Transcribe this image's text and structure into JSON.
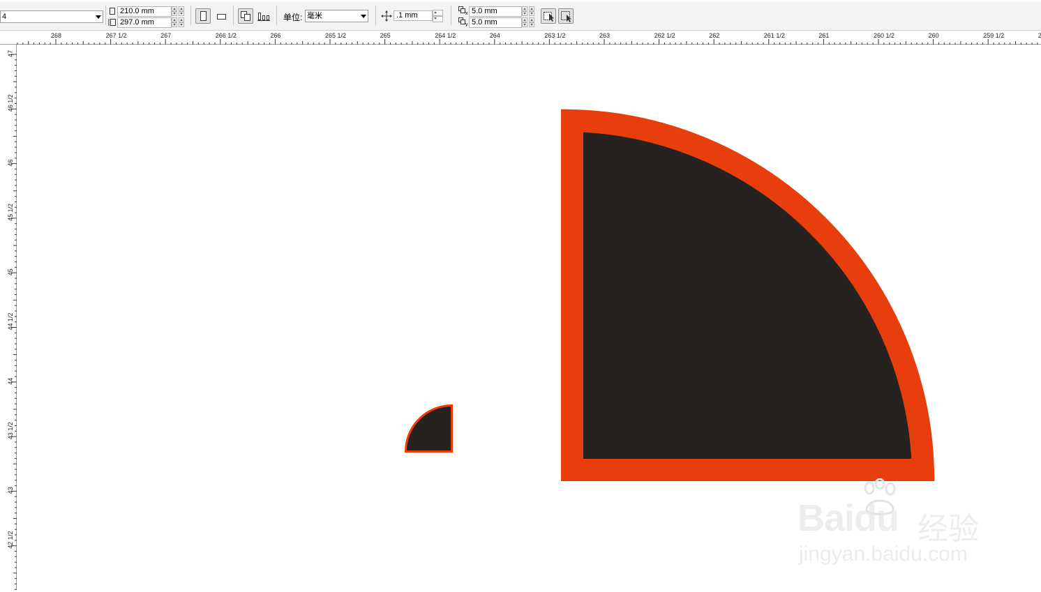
{
  "toolbar": {
    "paper_preset": "4",
    "page_width": "210.0 mm",
    "page_height": "297.0 mm",
    "units_label": "单位:",
    "units_value": "毫米",
    "nudge_value": ".1 mm",
    "dup_x": "5.0 mm",
    "dup_y": "5.0 mm"
  },
  "ruler_h": {
    "labels": [
      "268",
      "267 1/2",
      "267",
      "266 1/2",
      "266",
      "265 1/2",
      "265",
      "264 1/2",
      "264",
      "263 1/2",
      "263",
      "262 1/2",
      "262",
      "261 1/2",
      "261",
      "260 1/2",
      "260",
      "259 1/2",
      "2"
    ]
  },
  "ruler_v": {
    "labels": [
      "47",
      "46 1/2",
      "46",
      "45 1/2",
      "45",
      "44 1/2",
      "44",
      "43 1/2",
      "43",
      "42 1/2"
    ]
  },
  "canvas": {
    "shapes": [
      {
        "name": "small-quarter-circle",
        "fill": "#262220",
        "outline": "#e83d0c"
      },
      {
        "name": "large-quarter-circle",
        "fill": "#262220",
        "outline": "#e83d0c"
      }
    ]
  },
  "watermark": {
    "brand": "Bai",
    "brand_suffix": "du",
    "product": "经验",
    "url": "jingyan.baidu.com"
  },
  "colors": {
    "accent_outline": "#e83d0c",
    "shape_fill": "#262220"
  }
}
